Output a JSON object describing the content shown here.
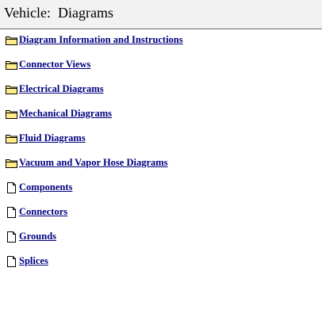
{
  "header": {
    "title": "Vehicle:  Diagrams"
  },
  "items": [
    {
      "label": "Diagram Information and Instructions",
      "icon": "folder-icon"
    },
    {
      "label": "Connector Views",
      "icon": "folder-icon"
    },
    {
      "label": "Electrical Diagrams",
      "icon": "folder-icon"
    },
    {
      "label": "Mechanical Diagrams",
      "icon": "folder-icon"
    },
    {
      "label": "Fluid Diagrams",
      "icon": "folder-icon"
    },
    {
      "label": "Vacuum and Vapor Hose Diagrams",
      "icon": "folder-icon"
    },
    {
      "label": "Components",
      "icon": "document-icon"
    },
    {
      "label": "Connectors",
      "icon": "document-icon"
    },
    {
      "label": "Grounds",
      "icon": "document-icon"
    },
    {
      "label": "Splices",
      "icon": "document-icon"
    }
  ],
  "colors": {
    "link": "#000080",
    "folder_fill": "#ffeb8a",
    "folder_stroke": "#000000",
    "header_bg": "#f2f2f2"
  }
}
